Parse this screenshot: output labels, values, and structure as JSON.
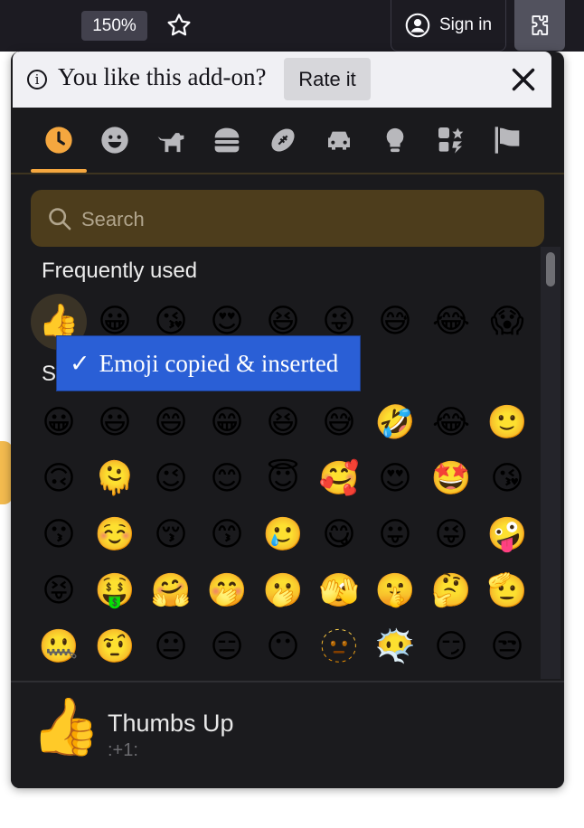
{
  "toolbar": {
    "zoom": "150%",
    "sign_in_label": "Sign in"
  },
  "notification": {
    "message": "You like this add-on?",
    "rate_label": "Rate it"
  },
  "categories": [
    {
      "name": "recent",
      "icon": "clock-icon",
      "active": true
    },
    {
      "name": "smileys",
      "icon": "smiley-icon"
    },
    {
      "name": "animals",
      "icon": "dog-icon"
    },
    {
      "name": "food",
      "icon": "burger-icon"
    },
    {
      "name": "activities",
      "icon": "football-icon"
    },
    {
      "name": "travel",
      "icon": "car-icon"
    },
    {
      "name": "objects",
      "icon": "lightbulb-icon"
    },
    {
      "name": "symbols",
      "icon": "symbols-icon"
    },
    {
      "name": "flags",
      "icon": "flag-icon"
    }
  ],
  "search": {
    "placeholder": "Search"
  },
  "sections": {
    "frequently_used": "Frequently used",
    "second_partial": "S"
  },
  "frequently_used": [
    "👍",
    "😀",
    "😘",
    "😍",
    "😆",
    "😜",
    "😅",
    "😂",
    "😱"
  ],
  "smileys_rows": [
    [
      "😀",
      "😃",
      "😄",
      "😁",
      "😆",
      "😅",
      "🤣",
      "😂",
      "🙂"
    ],
    [
      "🙃",
      "🫠",
      "😉",
      "😊",
      "😇",
      "🥰",
      "😍",
      "🤩",
      "😘"
    ],
    [
      "😗",
      "☺️",
      "😚",
      "😙",
      "🥲",
      "😋",
      "😛",
      "😜",
      "🤪"
    ],
    [
      "😝",
      "🤑",
      "🤗",
      "🤭",
      "🫢",
      "🫣",
      "🤫",
      "🤔",
      "🫡"
    ],
    [
      "🤐",
      "🤨",
      "😐",
      "😑",
      "😶",
      "🫥",
      "😶‍🌫️",
      "😏",
      "😒"
    ]
  ],
  "toast": {
    "check": "✓",
    "message": "Emoji copied & inserted"
  },
  "preview": {
    "emoji": "👍",
    "name": "Thumbs Up",
    "shortcode": ":+1:"
  },
  "colors": {
    "accent": "#f5a73f",
    "toast": "#2a5fd6",
    "panel": "#1a1a1d"
  }
}
